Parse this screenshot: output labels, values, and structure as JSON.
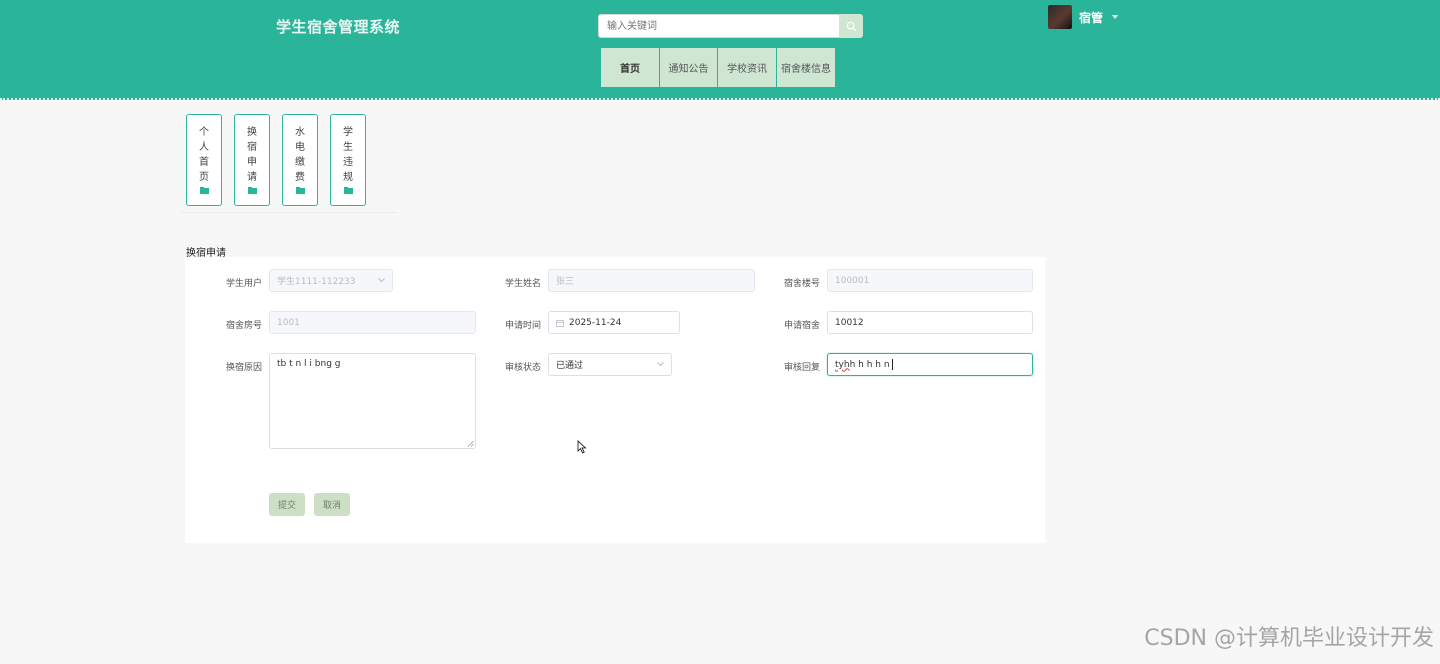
{
  "header": {
    "title": "学生宿舍管理系统",
    "search_placeholder": "输入关键词",
    "user_name": "宿管",
    "icons": {
      "search": "search-icon",
      "caret": "caret-down-icon",
      "avatar": "avatar"
    }
  },
  "nav": {
    "items": [
      {
        "label": "首页"
      },
      {
        "label": "通知公告"
      },
      {
        "label": "学校资讯"
      },
      {
        "label": "宿舍楼信息"
      }
    ]
  },
  "side_menu": {
    "items": [
      {
        "label": "个人首页"
      },
      {
        "label": "换宿申请"
      },
      {
        "label": "水电缴费"
      },
      {
        "label": "学生违规"
      }
    ]
  },
  "form": {
    "section_title": "换宿申请",
    "fields": {
      "student_user": {
        "label": "学生用户",
        "value": "学生1111-112233"
      },
      "student_name": {
        "label": "学生姓名",
        "value": "张三"
      },
      "building_no": {
        "label": "宿舍楼号",
        "value": "100001"
      },
      "room_no": {
        "label": "宿舍房号",
        "value": "1001"
      },
      "apply_time": {
        "label": "申请时间",
        "value": "2025-11-24"
      },
      "apply_room": {
        "label": "申请宿舍",
        "value": "10012"
      },
      "reason": {
        "label": "换宿原因",
        "value": "tb t n l i bng g"
      },
      "audit_status": {
        "label": "审核状态",
        "value": "已通过"
      },
      "audit_reply": {
        "label": "审核回复",
        "value_part1": "tyh",
        "value_part2": " h h h h n"
      }
    },
    "buttons": {
      "submit": "提交",
      "cancel": "取消"
    }
  },
  "watermark": "CSDN @计算机毕业设计开发",
  "colors": {
    "primary": "#2ab59b",
    "nav_bg": "#cfe7d2",
    "button_bg": "#cde0c6"
  }
}
